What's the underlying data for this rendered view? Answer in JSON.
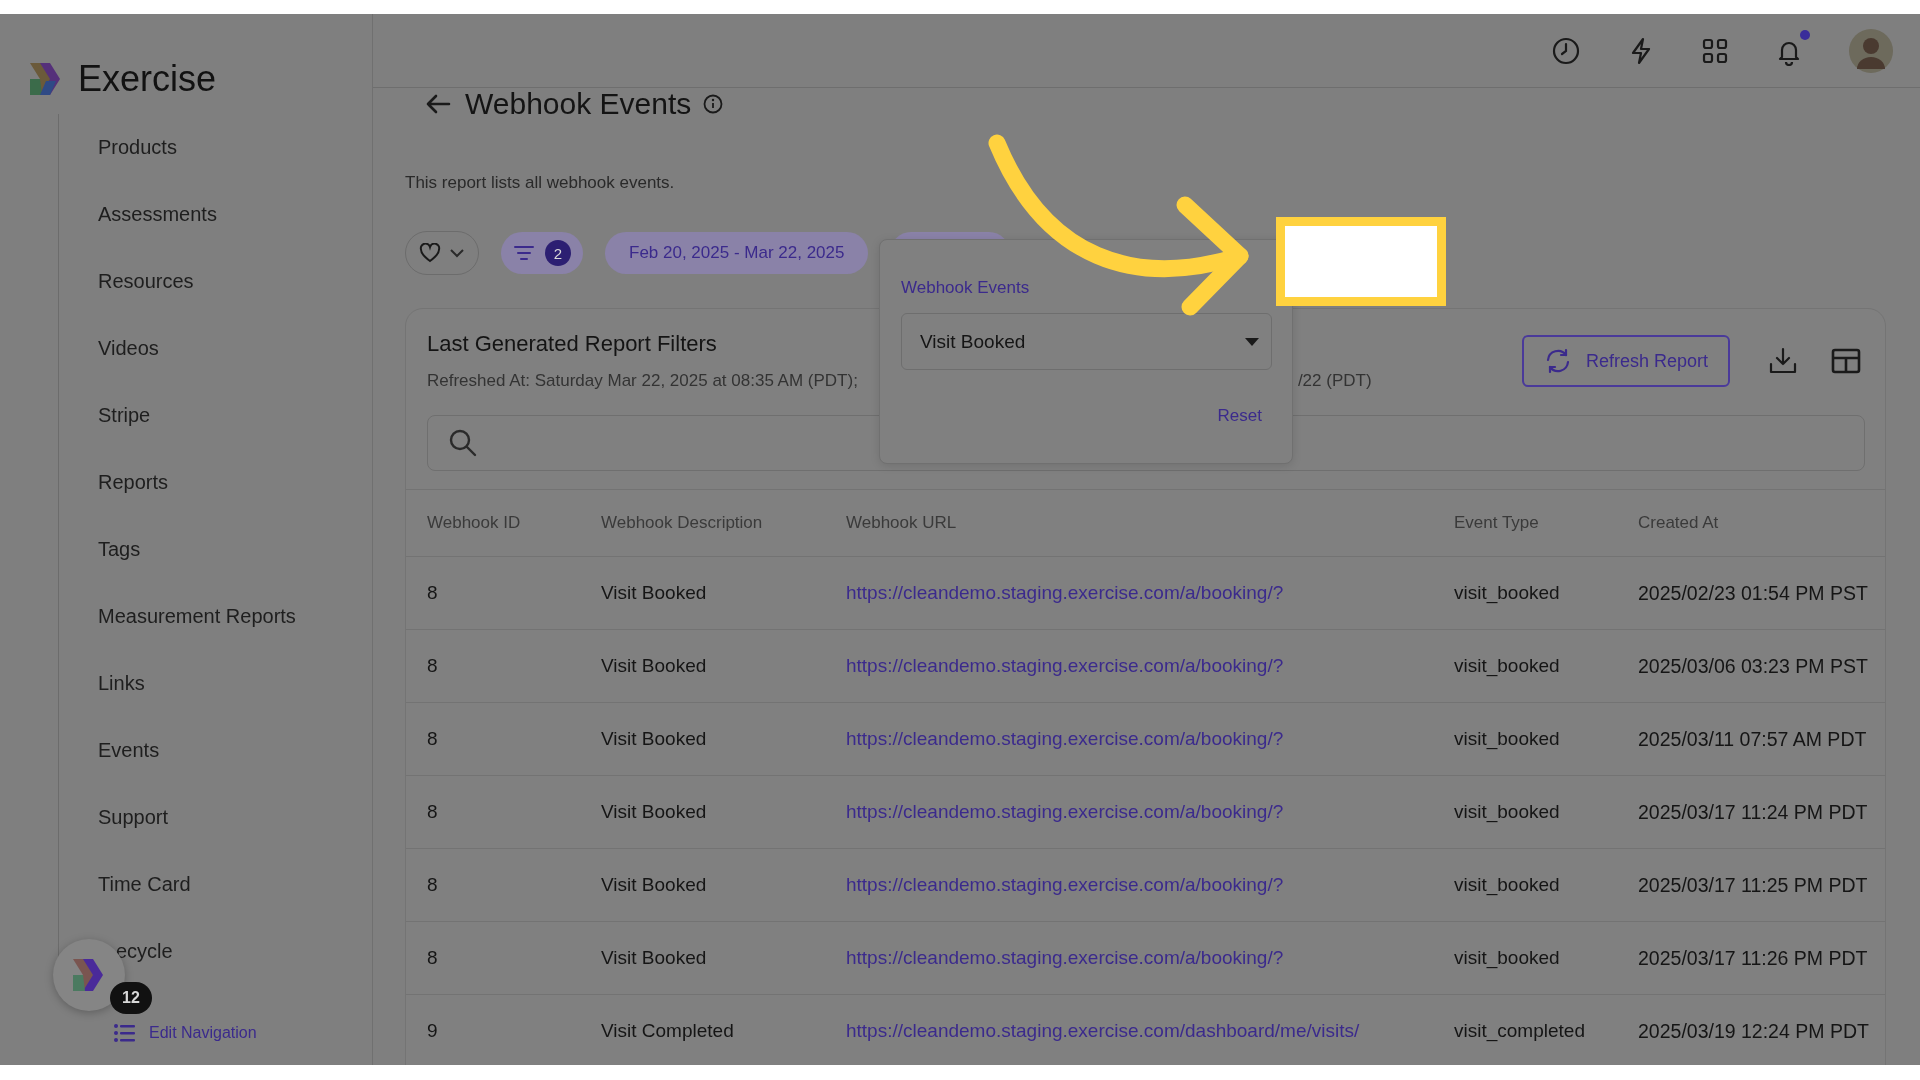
{
  "brand": {
    "name": "Exercise"
  },
  "header": {
    "notifications": {
      "unread": true
    }
  },
  "sidebar": {
    "items": [
      {
        "label": "Products",
        "kind": "link"
      },
      {
        "label": "Assessments",
        "kind": "link"
      },
      {
        "label": "Resources",
        "kind": "link"
      },
      {
        "label": "Videos",
        "kind": "link"
      },
      {
        "label": "Stripe",
        "kind": "link"
      },
      {
        "label": "Reports",
        "kind": "link"
      },
      {
        "label": "Tags",
        "kind": "link"
      },
      {
        "label": "Measurement Reports",
        "kind": "link"
      },
      {
        "label": "Links",
        "kind": "link"
      },
      {
        "label": "Events",
        "kind": "link"
      },
      {
        "label": "Support",
        "kind": "link"
      },
      {
        "label": "Time Card",
        "kind": "link"
      },
      {
        "label": "ecycle",
        "kind": "covered"
      }
    ],
    "launcher_badge": "12",
    "edit_navigation": "Edit Navigation"
  },
  "page": {
    "title": "Webhook Events",
    "description": "This report lists all webhook events."
  },
  "filters": {
    "filter_count": "2",
    "date_range": "Feb 20, 2025 - Mar 22, 2025"
  },
  "popup": {
    "label": "Webhook Events",
    "value": "Visit Booked",
    "reset": "Reset"
  },
  "report": {
    "title": "Last Generated Report Filters",
    "refreshed": "Refreshed At: Saturday Mar 22, 2025 at 08:35 AM (PDT);",
    "refreshed_tail": "/22 (PDT)",
    "refresh_button": "Refresh Report"
  },
  "table": {
    "columns": [
      "Webhook ID",
      "Webhook Description",
      "Webhook URL",
      "Event Type",
      "Created At"
    ],
    "rows": [
      [
        "8",
        "Visit Booked",
        "https://cleandemo.staging.exercise.com/a/booking/?",
        "visit_booked",
        "2025/02/23 01:54 PM PST"
      ],
      [
        "8",
        "Visit Booked",
        "https://cleandemo.staging.exercise.com/a/booking/?",
        "visit_booked",
        "2025/03/06 03:23 PM PST"
      ],
      [
        "8",
        "Visit Booked",
        "https://cleandemo.staging.exercise.com/a/booking/?",
        "visit_booked",
        "2025/03/11 07:57 AM PDT"
      ],
      [
        "8",
        "Visit Booked",
        "https://cleandemo.staging.exercise.com/a/booking/?",
        "visit_booked",
        "2025/03/17 11:24 PM PDT"
      ],
      [
        "8",
        "Visit Booked",
        "https://cleandemo.staging.exercise.com/a/booking/?",
        "visit_booked",
        "2025/03/17 11:25 PM PDT"
      ],
      [
        "8",
        "Visit Booked",
        "https://cleandemo.staging.exercise.com/a/booking/?",
        "visit_booked",
        "2025/03/17 11:26 PM PDT"
      ],
      [
        "9",
        "Visit Completed",
        "https://cleandemo.staging.exercise.com/dashboard/me/visits/",
        "visit_completed",
        "2025/03/19 12:24 PM PDT"
      ]
    ]
  }
}
